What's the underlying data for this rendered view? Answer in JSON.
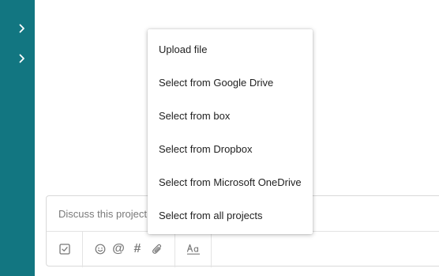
{
  "sidebar": {
    "items": [
      {
        "icon": "chevron-right-icon"
      },
      {
        "icon": "chevron-right-icon"
      }
    ]
  },
  "composer": {
    "placeholder": "Discuss this project",
    "toolbar": {
      "icons": [
        "checkbox-icon",
        "emoji-icon",
        "mention-icon",
        "hashtag-icon",
        "attachment-icon",
        "text-format-icon"
      ],
      "mention_glyph": "@",
      "hashtag_glyph": "#"
    }
  },
  "attach_menu": {
    "items": [
      {
        "label": "Upload file"
      },
      {
        "label": "Select from Google Drive"
      },
      {
        "label": "Select from box"
      },
      {
        "label": "Select from Dropbox"
      },
      {
        "label": "Select from Microsoft OneDrive"
      },
      {
        "label": "Select from all projects"
      }
    ]
  },
  "colors": {
    "sidebar": "#127681",
    "icon_gray": "#777777"
  }
}
